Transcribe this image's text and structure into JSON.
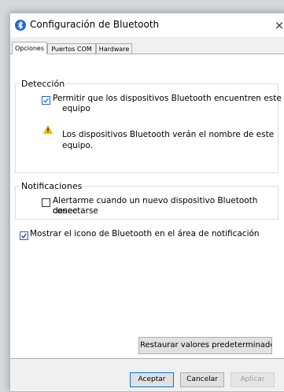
{
  "window": {
    "title": "Configuración de Bluetooth",
    "close_glyph": "×"
  },
  "tabs": [
    {
      "label": "Opciones",
      "active": true
    },
    {
      "label": "Puertos COM",
      "active": false
    },
    {
      "label": "Hardware",
      "active": false
    }
  ],
  "detection": {
    "legend": "Detección",
    "allow_discovery": {
      "line1": "Permitir que los dispositivos Bluetooth encuentren este",
      "line2": "equipo",
      "checked": true
    },
    "warning": {
      "icon": "warning-icon",
      "line1": "Los dispositivos Bluetooth verán el nombre de este",
      "line2": "equipo."
    }
  },
  "notifications": {
    "legend": "Notificaciones",
    "alert_new_device": {
      "line1": "Alertarme cuando un nuevo dispositivo Bluetooth desee",
      "line2": "conectarse",
      "checked": false
    }
  },
  "show_tray_icon": {
    "label": "Mostrar el icono de Bluetooth en el área de notificación",
    "checked": true
  },
  "buttons": {
    "restore": "Restaurar valores predeterminados",
    "accept": "Aceptar",
    "cancel": "Cancelar",
    "apply": "Aplicar"
  },
  "colors": {
    "accent": "#0078d7",
    "bluetooth": "#1f6ad0",
    "warning": "#f2c100"
  }
}
